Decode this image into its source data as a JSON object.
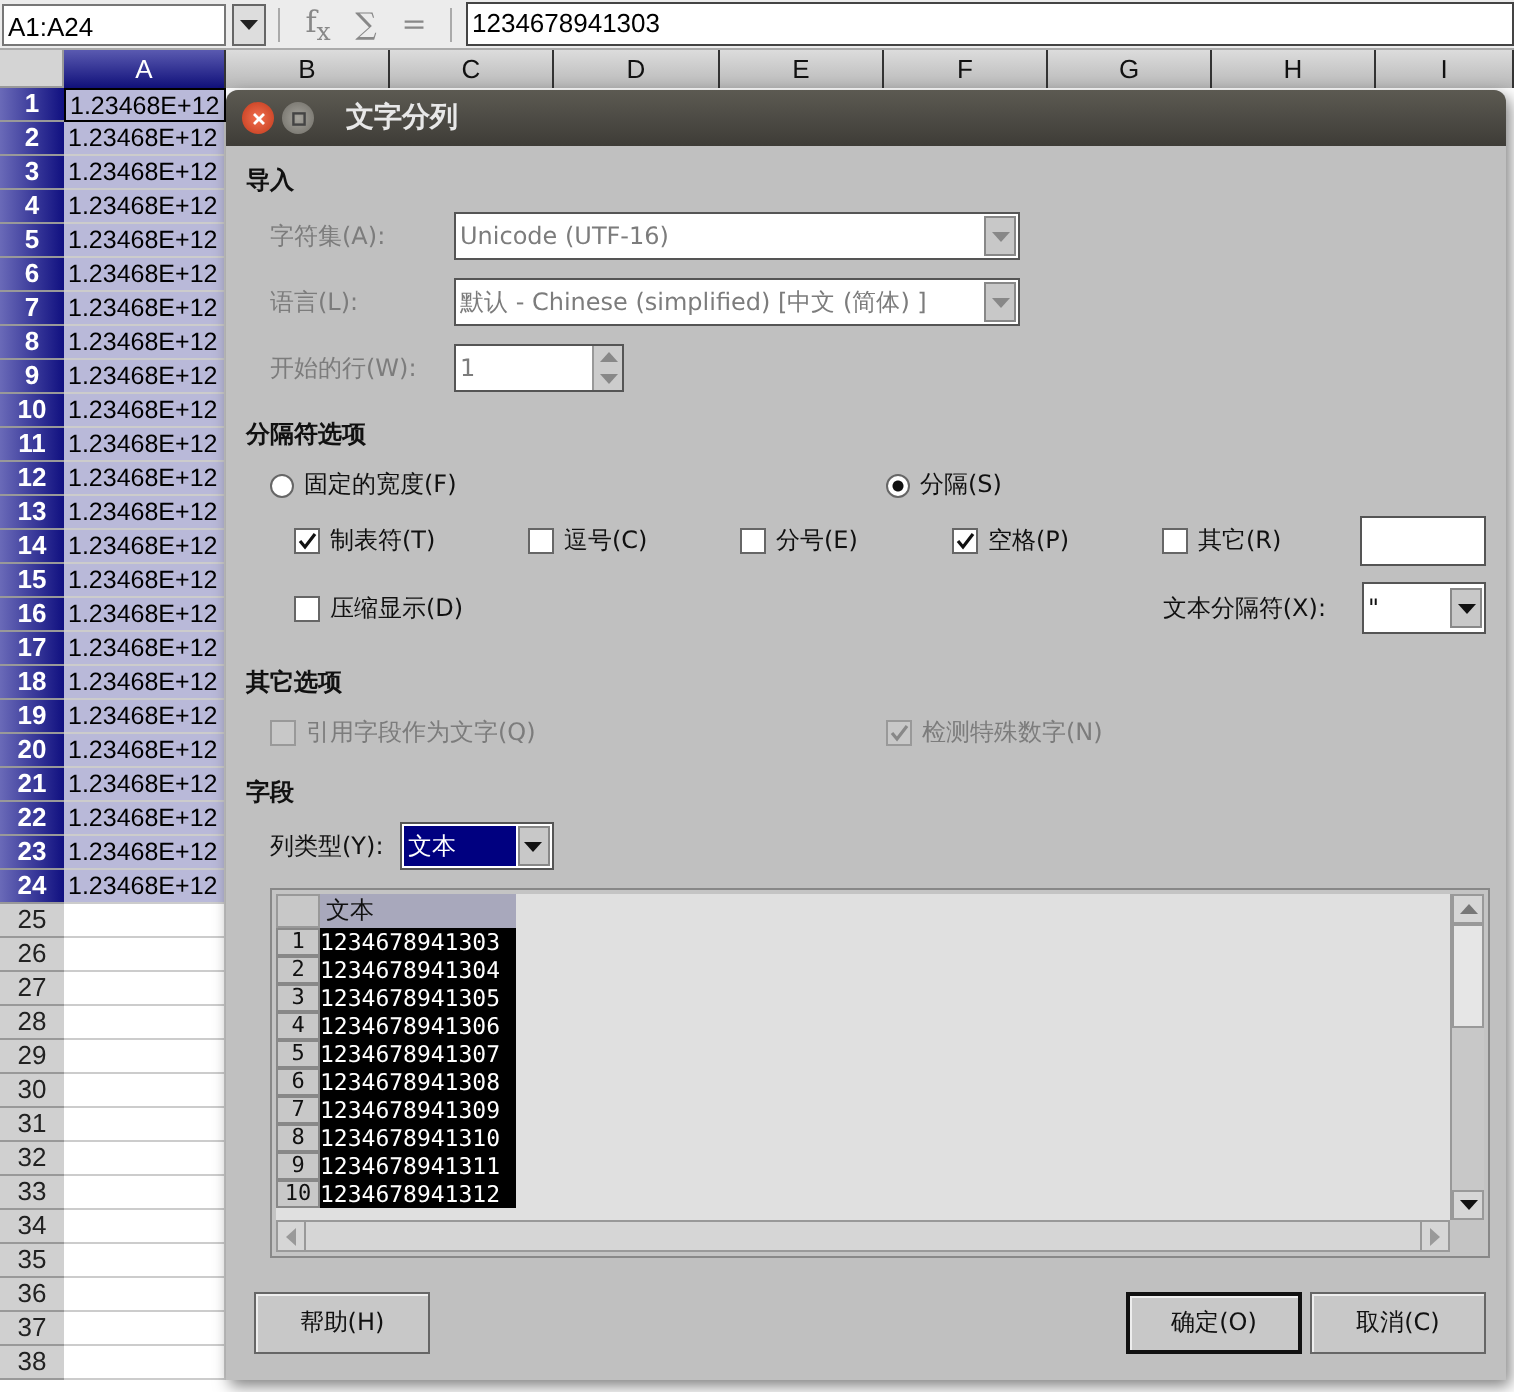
{
  "toolbar": {
    "name_box": "A1:A24",
    "icons": [
      "f$_{x}$",
      "∑",
      "="
    ],
    "formula": "1234678941303"
  },
  "sheet": {
    "columns": [
      {
        "label": "A",
        "selected": true
      },
      {
        "label": "B",
        "selected": false
      },
      {
        "label": "C",
        "selected": false
      },
      {
        "label": "D",
        "selected": false
      },
      {
        "label": "E",
        "selected": false
      },
      {
        "label": "F",
        "selected": false
      },
      {
        "label": "G",
        "selected": false
      },
      {
        "label": "H",
        "selected": false
      },
      {
        "label": "I",
        "selected": false
      }
    ],
    "rows": [
      {
        "number": "1",
        "value": "1.23468E+12",
        "selected": true
      },
      {
        "number": "2",
        "value": "1.23468E+12",
        "selected": true
      },
      {
        "number": "3",
        "value": "1.23468E+12",
        "selected": true
      },
      {
        "number": "4",
        "value": "1.23468E+12",
        "selected": true
      },
      {
        "number": "5",
        "value": "1.23468E+12",
        "selected": true
      },
      {
        "number": "6",
        "value": "1.23468E+12",
        "selected": true
      },
      {
        "number": "7",
        "value": "1.23468E+12",
        "selected": true
      },
      {
        "number": "8",
        "value": "1.23468E+12",
        "selected": true
      },
      {
        "number": "9",
        "value": "1.23468E+12",
        "selected": true
      },
      {
        "number": "10",
        "value": "1.23468E+12",
        "selected": true
      },
      {
        "number": "11",
        "value": "1.23468E+12",
        "selected": true
      },
      {
        "number": "12",
        "value": "1.23468E+12",
        "selected": true
      },
      {
        "number": "13",
        "value": "1.23468E+12",
        "selected": true
      },
      {
        "number": "14",
        "value": "1.23468E+12",
        "selected": true
      },
      {
        "number": "15",
        "value": "1.23468E+12",
        "selected": true
      },
      {
        "number": "16",
        "value": "1.23468E+12",
        "selected": true
      },
      {
        "number": "17",
        "value": "1.23468E+12",
        "selected": true
      },
      {
        "number": "18",
        "value": "1.23468E+12",
        "selected": true
      },
      {
        "number": "19",
        "value": "1.23468E+12",
        "selected": true
      },
      {
        "number": "20",
        "value": "1.23468E+12",
        "selected": true
      },
      {
        "number": "21",
        "value": "1.23468E+12",
        "selected": true
      },
      {
        "number": "22",
        "value": "1.23468E+12",
        "selected": true
      },
      {
        "number": "23",
        "value": "1.23468E+12",
        "selected": true
      },
      {
        "number": "24",
        "value": "1.23468E+12",
        "selected": true
      },
      {
        "number": "25",
        "selected": false
      },
      {
        "number": "26",
        "selected": false
      },
      {
        "number": "27",
        "selected": false
      },
      {
        "number": "28",
        "selected": false
      },
      {
        "number": "29",
        "selected": false
      },
      {
        "number": "30",
        "selected": false
      },
      {
        "number": "31",
        "selected": false
      },
      {
        "number": "32",
        "selected": false
      },
      {
        "number": "33",
        "selected": false
      },
      {
        "number": "34",
        "selected": false
      },
      {
        "number": "35",
        "selected": false
      },
      {
        "number": "36",
        "selected": false
      },
      {
        "number": "37",
        "selected": false
      },
      {
        "number": "38",
        "selected": false
      }
    ]
  },
  "dialog": {
    "title": "文字分列",
    "import": {
      "title": "导入",
      "fields": [
        {
          "kind": "dropdown",
          "label": "字符集(A):",
          "value": "Unicode (UTF-16)",
          "disabled": true
        },
        {
          "kind": "dropdown",
          "label": "语言(L):",
          "value": "默认 - Chinese (simplified) [中文 (简体) ]",
          "disabled": true
        },
        {
          "kind": "spinner",
          "label": "开始的行(W):",
          "value": "1",
          "disabled": true
        }
      ]
    },
    "separator_options": {
      "title": "分隔符选项",
      "modes": [
        {
          "label": "固定的宽度(F)",
          "selected": false
        },
        {
          "label": "分隔(S)",
          "selected": true
        }
      ],
      "delimiters": [
        {
          "label": "制表符(T)",
          "checked": true
        },
        {
          "label": "逗号(C)",
          "checked": false
        },
        {
          "label": "分号(E)",
          "checked": false
        },
        {
          "label": "空格(P)",
          "checked": true
        },
        {
          "label": "其它(R)",
          "checked": false
        }
      ],
      "merge": {
        "label": "压缩显示(D)",
        "checked": false
      },
      "text_delimiter": {
        "label": "文本分隔符(X):",
        "value": "\""
      }
    },
    "other_options": {
      "title": "其它选项",
      "checkboxes": [
        {
          "label": "引用字段作为文字(Q)",
          "checked": false,
          "disabled": true
        },
        {
          "label": "检测特殊数字(N)",
          "checked": true,
          "disabled": true
        }
      ]
    },
    "fields": {
      "title": "字段",
      "column_type": {
        "label": "列类型(Y):",
        "value": "文本"
      }
    },
    "preview": {
      "column": "文本",
      "rows": [
        {
          "number": "1",
          "value": "1234678941303"
        },
        {
          "number": "2",
          "value": "1234678941304"
        },
        {
          "number": "3",
          "value": "1234678941305"
        },
        {
          "number": "4",
          "value": "1234678941306"
        },
        {
          "number": "5",
          "value": "1234678941307"
        },
        {
          "number": "6",
          "value": "1234678941308"
        },
        {
          "number": "7",
          "value": "1234678941309"
        },
        {
          "number": "8",
          "value": "1234678941310"
        },
        {
          "number": "9",
          "value": "1234678941311"
        },
        {
          "number": "10",
          "value": "1234678941312"
        }
      ]
    },
    "buttons": {
      "help": "帮助(H)",
      "ok": "确定(O)",
      "cancel": "取消(C)"
    }
  }
}
